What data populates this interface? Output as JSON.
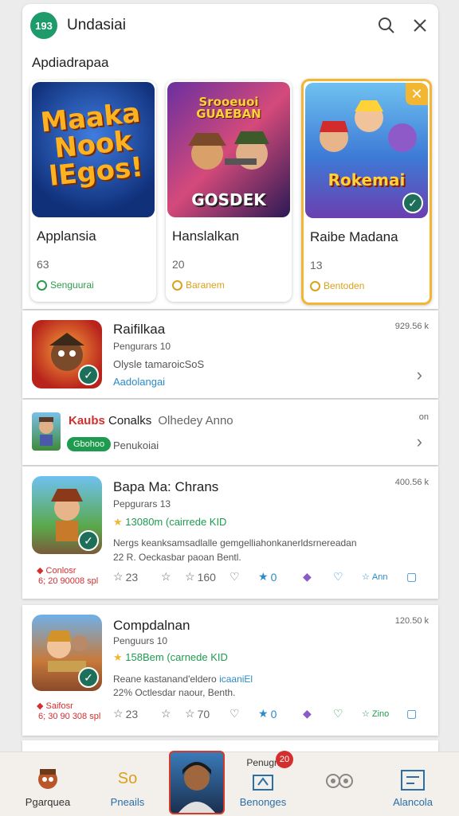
{
  "header": {
    "logo_text": "193",
    "title": "Undasiai",
    "search_icon": "search-icon",
    "close_icon": "close-icon"
  },
  "featured": {
    "section_title": "Apdiadrapaa",
    "cards": [
      {
        "art_text": "Maaka Nook lEgos!",
        "name": "Applansia",
        "number": "63",
        "tag": "Senguurai",
        "tag_color": "#2e9b4e"
      },
      {
        "art_text_top": "Srooeuoi GUAEBAN",
        "art_text_bottom": "GOSDEK",
        "name": "Hanslalkan",
        "number": "20",
        "tag": "Baranem",
        "tag_color": "#d9a21b"
      },
      {
        "art_text": "Rokemai",
        "name": "Raibe Madana",
        "number": "13",
        "tag": "Bentoden",
        "tag_color": "#d9a21b"
      }
    ]
  },
  "list": [
    {
      "title": "Raifilkaa",
      "sub1": "Pengurars 10",
      "sub2": "Olysle tamaroicSoS",
      "sub3": "Aadolangai",
      "right": "929.56 k"
    },
    {
      "title_red": "Kaubs",
      "title": "Conalks",
      "title_extra": "Olhedey Anno",
      "badge": "Gbohoo",
      "sub": "Penukoiai",
      "right": "on"
    },
    {
      "title": "Bapa Ma: Chrans",
      "sub1": "Pepgurars 13",
      "rating": "13080m (cairrede KID",
      "desc": "Nergs keanksamsadlalle gemgelliahonkanerldsrnereadan",
      "desc2": "22 R. Oeckasbar paoan Bentl.",
      "price_label": "Conlosr",
      "price_value": "6; 20 90008 spl",
      "right": "400.56 k",
      "actions": [
        "23",
        "",
        "160",
        "",
        "0",
        "",
        "",
        "Ann",
        ""
      ]
    },
    {
      "title": "Compdalnan",
      "sub1": "Penguurs 10",
      "rating": "158Bem (carnede KID",
      "desc": "Reane kastanand'eldero",
      "desc_blue": "icaaniEl",
      "desc2": "22% Octlesdar naour, Benth.",
      "price_label": "Saifosr",
      "price_value": "6; 30 90 308 spl",
      "right": "120.50 k",
      "actions": [
        "23",
        "",
        "70",
        "",
        "0",
        "",
        "",
        "Zino",
        ""
      ]
    }
  ],
  "bottom_nav": {
    "items": [
      {
        "label": "Pgarquea"
      },
      {
        "label": "Pneails",
        "icon_text": "So"
      },
      {
        "label": ""
      },
      {
        "label": "Benonges",
        "above": "Penugn",
        "badge": "20"
      },
      {
        "label": ""
      },
      {
        "label": "Alancola"
      }
    ]
  },
  "colors": {
    "accent_green": "#1e9b6b",
    "link_blue": "#2a8bc8",
    "badge_red": "#d32f2f",
    "gold": "#f2b632"
  }
}
